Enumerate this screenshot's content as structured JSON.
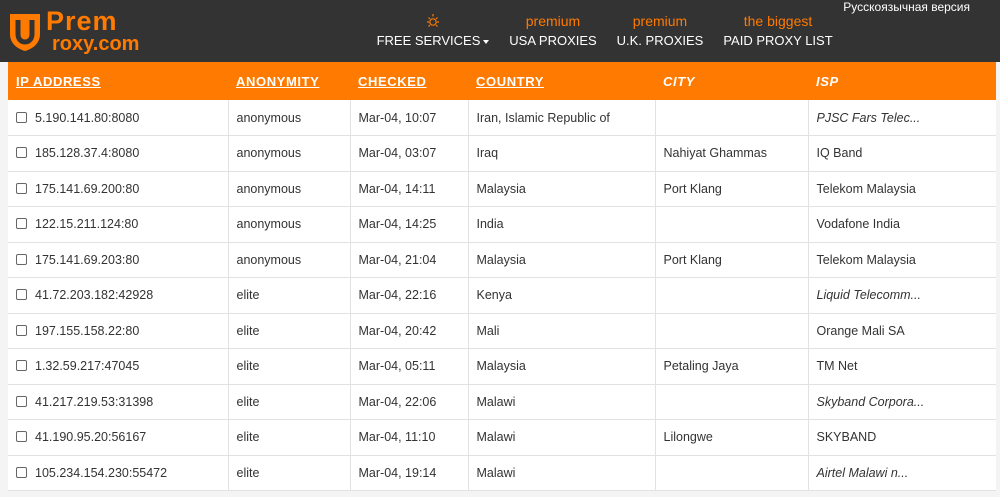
{
  "brand": {
    "logo_top": "Prem",
    "logo_bottom": "roxy.com"
  },
  "nav": [
    {
      "top": "",
      "label": "FREE SERVICES",
      "icon": "sun-icon",
      "dropdown": true
    },
    {
      "top": "premium",
      "label": "USA PROXIES"
    },
    {
      "top": "premium",
      "label": "U.K. PROXIES"
    },
    {
      "top": "the biggest",
      "label": "PAID PROXY LIST"
    }
  ],
  "lang_link": "Русскоязычная версия",
  "colors": {
    "accent": "#ff7a00",
    "topbar": "#333333"
  },
  "table": {
    "headers": [
      "IP ADDRESS",
      "ANONYMITY",
      "CHECKED",
      "COUNTRY",
      "CITY",
      "ISP"
    ],
    "rows": [
      {
        "ip": "5.190.141.80:8080",
        "anon": "anonymous",
        "checked": "Mar-04, 10:07",
        "country": "Iran, Islamic Republic of",
        "city": "",
        "isp": "PJSC Fars Telec...",
        "isp_italic": true
      },
      {
        "ip": "185.128.37.4:8080",
        "anon": "anonymous",
        "checked": "Mar-04, 03:07",
        "country": "Iraq",
        "city": "Nahiyat Ghammas",
        "isp": "IQ Band",
        "isp_italic": false
      },
      {
        "ip": "175.141.69.200:80",
        "anon": "anonymous",
        "checked": "Mar-04, 14:11",
        "country": "Malaysia",
        "city": "Port Klang",
        "isp": "Telekom Malaysia",
        "isp_italic": false
      },
      {
        "ip": "122.15.211.124:80",
        "anon": "anonymous",
        "checked": "Mar-04, 14:25",
        "country": "India",
        "city": "",
        "isp": "Vodafone India",
        "isp_italic": false
      },
      {
        "ip": "175.141.69.203:80",
        "anon": "anonymous",
        "checked": "Mar-04, 21:04",
        "country": "Malaysia",
        "city": "Port Klang",
        "isp": "Telekom Malaysia",
        "isp_italic": false
      },
      {
        "ip": "41.72.203.182:42928",
        "anon": "elite",
        "checked": "Mar-04, 22:16",
        "country": "Kenya",
        "city": "",
        "isp": "Liquid Telecomm...",
        "isp_italic": true
      },
      {
        "ip": "197.155.158.22:80",
        "anon": "elite",
        "checked": "Mar-04, 20:42",
        "country": "Mali",
        "city": "",
        "isp": "Orange Mali SA",
        "isp_italic": false
      },
      {
        "ip": "1.32.59.217:47045",
        "anon": "elite",
        "checked": "Mar-04, 05:11",
        "country": "Malaysia",
        "city": "Petaling Jaya",
        "isp": "TM Net",
        "isp_italic": false
      },
      {
        "ip": "41.217.219.53:31398",
        "anon": "elite",
        "checked": "Mar-04, 22:06",
        "country": "Malawi",
        "city": "",
        "isp": "Skyband Corpora...",
        "isp_italic": true
      },
      {
        "ip": "41.190.95.20:56167",
        "anon": "elite",
        "checked": "Mar-04, 11:10",
        "country": "Malawi",
        "city": "Lilongwe",
        "isp": "SKYBAND",
        "isp_italic": false
      },
      {
        "ip": "105.234.154.230:55472",
        "anon": "elite",
        "checked": "Mar-04, 19:14",
        "country": "Malawi",
        "city": "",
        "isp": "Airtel Malawi n...",
        "isp_italic": true
      }
    ]
  }
}
